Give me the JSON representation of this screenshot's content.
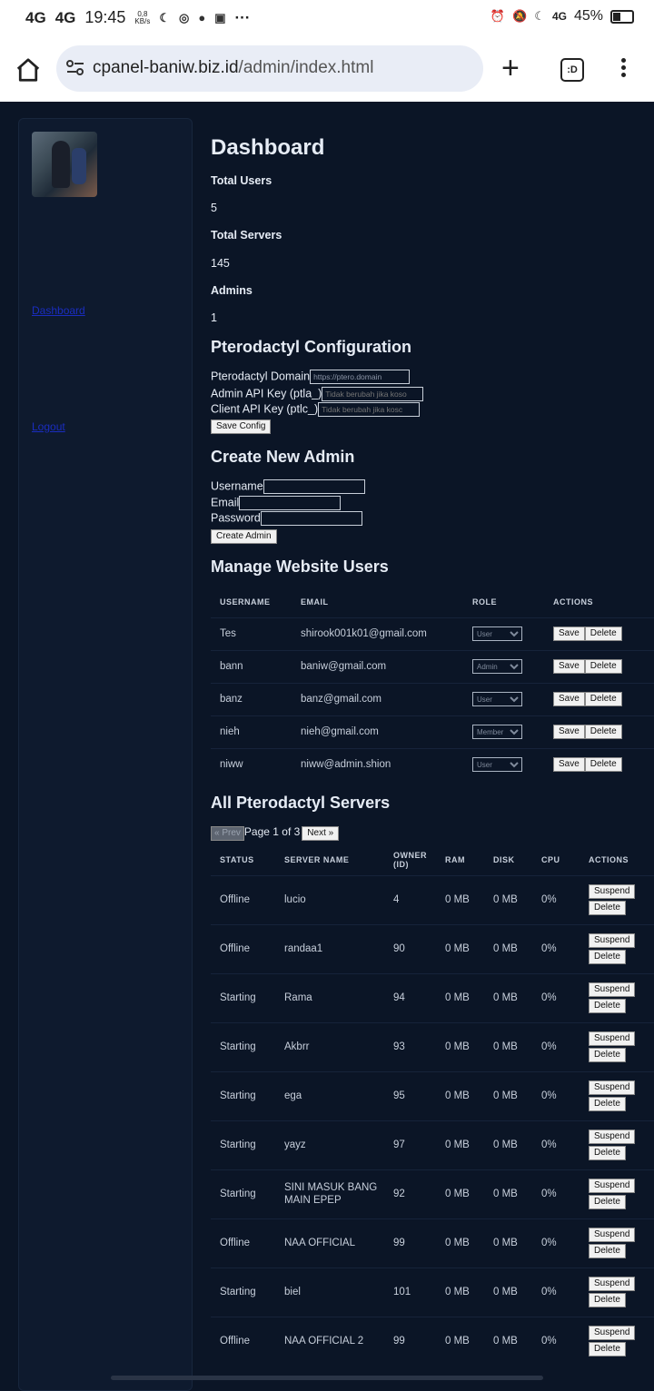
{
  "status_bar": {
    "network1": "4G",
    "network2": "4G",
    "time": "19:45",
    "speed_value": "0,8",
    "speed_unit": "KB/s",
    "more": "···",
    "signal": "4G",
    "battery": "45%"
  },
  "browser": {
    "url_domain": "cpanel-baniw.biz.id",
    "url_path": "/admin/index.html",
    "tabs_label": ":D"
  },
  "sidebar": {
    "link_dashboard": "Dashboard",
    "link_logout": "Logout"
  },
  "dashboard": {
    "title": "Dashboard",
    "total_users_label": "Total Users",
    "total_users_value": "5",
    "total_servers_label": "Total Servers",
    "total_servers_value": "145",
    "admins_label": "Admins",
    "admins_value": "1"
  },
  "ptero_config": {
    "title": "Pterodactyl Configuration",
    "domain_label": "Pterodactyl Domain",
    "domain_value": "https://ptero.domain",
    "admin_key_label": "Admin API Key (ptla_)",
    "admin_key_placeholder": "Tidak berubah jika koso",
    "client_key_label": "Client API Key (ptlc_)",
    "client_key_placeholder": "Tidak berubah jika kosc",
    "save_button": "Save Config"
  },
  "create_admin": {
    "title": "Create New Admin",
    "username_label": "Username",
    "email_label": "Email",
    "password_label": "Password",
    "create_button": "Create Admin"
  },
  "manage_users": {
    "title": "Manage Website Users",
    "headers": [
      "USERNAME",
      "EMAIL",
      "ROLE",
      "ACTIONS"
    ],
    "save_label": "Save",
    "delete_label": "Delete",
    "rows": [
      {
        "username": "Tes",
        "email": "shirook001k01@gmail.com",
        "role": "User"
      },
      {
        "username": "bann",
        "email": "baniw@gmail.com",
        "role": "Admin"
      },
      {
        "username": "banz",
        "email": "banz@gmail.com",
        "role": "User"
      },
      {
        "username": "nieh",
        "email": "nieh@gmail.com",
        "role": "Member"
      },
      {
        "username": "niww",
        "email": "niww@admin.shion",
        "role": "User"
      }
    ]
  },
  "servers": {
    "title": "All Pterodactyl Servers",
    "prev_label": "« Prev",
    "page_text": "Page 1 of 3",
    "next_label": "Next »",
    "headers": [
      "STATUS",
      "SERVER NAME",
      "OWNER (ID)",
      "RAM",
      "DISK",
      "CPU",
      "ACTIONS"
    ],
    "suspend_label": "Suspend",
    "delete_label": "Delete",
    "rows": [
      {
        "status": "Offline",
        "name": "lucio",
        "owner": "4",
        "ram": "0 MB",
        "disk": "0 MB",
        "cpu": "0%"
      },
      {
        "status": "Offline",
        "name": "randaa1",
        "owner": "90",
        "ram": "0 MB",
        "disk": "0 MB",
        "cpu": "0%"
      },
      {
        "status": "Starting",
        "name": "Rama",
        "owner": "94",
        "ram": "0 MB",
        "disk": "0 MB",
        "cpu": "0%"
      },
      {
        "status": "Starting",
        "name": "Akbrr",
        "owner": "93",
        "ram": "0 MB",
        "disk": "0 MB",
        "cpu": "0%"
      },
      {
        "status": "Starting",
        "name": "ega",
        "owner": "95",
        "ram": "0 MB",
        "disk": "0 MB",
        "cpu": "0%"
      },
      {
        "status": "Starting",
        "name": "yayz",
        "owner": "97",
        "ram": "0 MB",
        "disk": "0 MB",
        "cpu": "0%"
      },
      {
        "status": "Starting",
        "name": "SINI MASUK BANG MAIN EPEP",
        "owner": "92",
        "ram": "0 MB",
        "disk": "0 MB",
        "cpu": "0%"
      },
      {
        "status": "Offline",
        "name": "NAA OFFICIAL",
        "owner": "99",
        "ram": "0 MB",
        "disk": "0 MB",
        "cpu": "0%"
      },
      {
        "status": "Starting",
        "name": "biel",
        "owner": "101",
        "ram": "0 MB",
        "disk": "0 MB",
        "cpu": "0%"
      },
      {
        "status": "Offline",
        "name": "NAA OFFICIAL 2",
        "owner": "99",
        "ram": "0 MB",
        "disk": "0 MB",
        "cpu": "0%"
      }
    ]
  }
}
